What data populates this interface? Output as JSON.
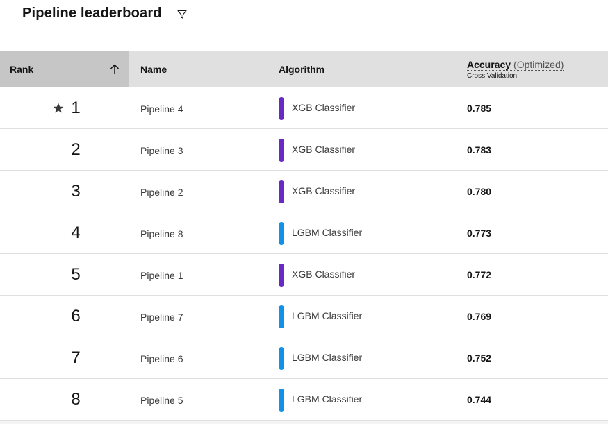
{
  "header": {
    "title": "Pipeline leaderboard",
    "filter_icon": "filter-icon"
  },
  "table": {
    "columns": {
      "rank": "Rank",
      "name": "Name",
      "algorithm": "Algorithm",
      "accuracy": "Accuracy",
      "accuracy_qualifier": "(Optimized)",
      "accuracy_subtitle": "Cross Validation"
    },
    "sort": {
      "column": "rank",
      "direction": "ascending",
      "icon": "arrow-up-icon"
    },
    "rows": [
      {
        "rank": "1",
        "starred": true,
        "name": "Pipeline 4",
        "algorithm": "XGB Classifier",
        "algorithm_color": "#6929c4",
        "accuracy": "0.785"
      },
      {
        "rank": "2",
        "starred": false,
        "name": "Pipeline 3",
        "algorithm": "XGB Classifier",
        "algorithm_color": "#6929c4",
        "accuracy": "0.783"
      },
      {
        "rank": "3",
        "starred": false,
        "name": "Pipeline 2",
        "algorithm": "XGB Classifier",
        "algorithm_color": "#6929c4",
        "accuracy": "0.780"
      },
      {
        "rank": "4",
        "starred": false,
        "name": "Pipeline 8",
        "algorithm": "LGBM Classifier",
        "algorithm_color": "#1192e8",
        "accuracy": "0.773"
      },
      {
        "rank": "5",
        "starred": false,
        "name": "Pipeline 1",
        "algorithm": "XGB Classifier",
        "algorithm_color": "#6929c4",
        "accuracy": "0.772"
      },
      {
        "rank": "6",
        "starred": false,
        "name": "Pipeline 7",
        "algorithm": "LGBM Classifier",
        "algorithm_color": "#1192e8",
        "accuracy": "0.769"
      },
      {
        "rank": "7",
        "starred": false,
        "name": "Pipeline 6",
        "algorithm": "LGBM Classifier",
        "algorithm_color": "#1192e8",
        "accuracy": "0.752"
      },
      {
        "rank": "8",
        "starred": false,
        "name": "Pipeline 5",
        "algorithm": "LGBM Classifier",
        "algorithm_color": "#1192e8",
        "accuracy": "0.744"
      }
    ]
  },
  "colors": {
    "header_bg": "#e0e0e0",
    "sorted_header_bg": "#c6c6c6",
    "xgb": "#6929c4",
    "lgbm": "#1192e8"
  }
}
